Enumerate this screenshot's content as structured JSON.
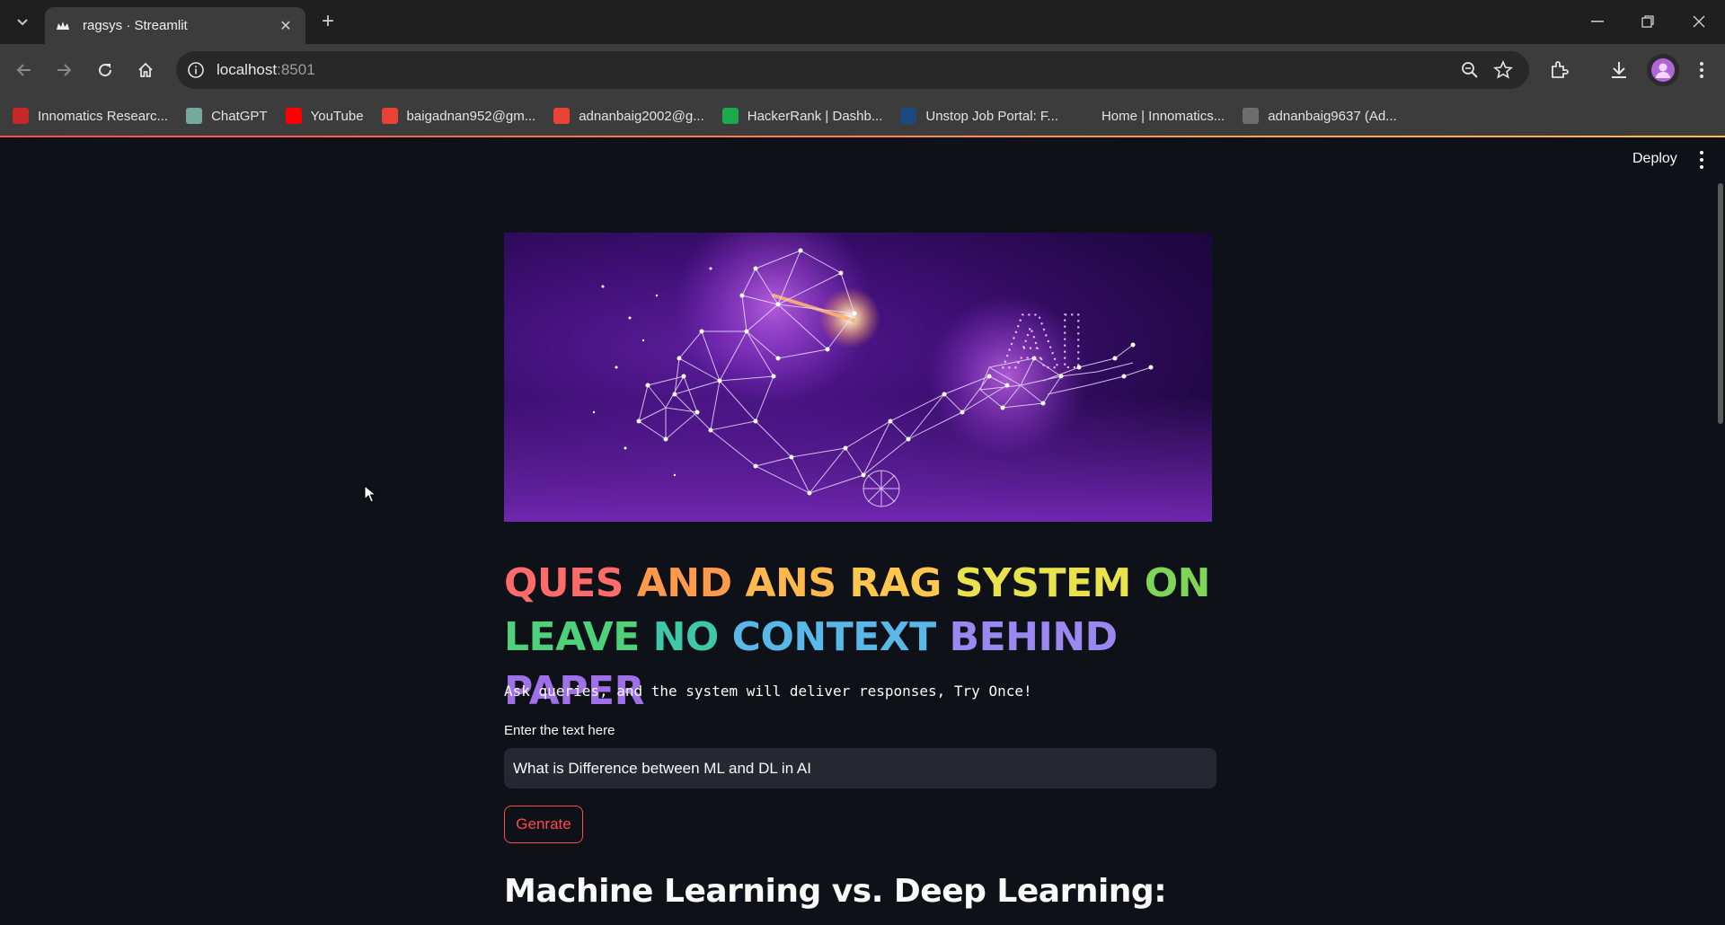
{
  "browser": {
    "tab_title": "ragsys · Streamlit",
    "url_host": "localhost",
    "url_port": ":8501",
    "bookmarks": [
      {
        "label": "Innomatics Researc...",
        "icon": "innomatics-icon",
        "color": "#c62828"
      },
      {
        "label": "ChatGPT",
        "icon": "chatgpt-icon",
        "color": "#74aa9c"
      },
      {
        "label": "YouTube",
        "icon": "youtube-icon",
        "color": "#ff0000"
      },
      {
        "label": "baigadnan952@gm...",
        "icon": "gmail-icon",
        "color": "#ea4335"
      },
      {
        "label": "adnanbaig2002@g...",
        "icon": "gmail-icon",
        "color": "#ea4335"
      },
      {
        "label": "HackerRank | Dashb...",
        "icon": "hackerrank-icon",
        "color": "#1ba94c"
      },
      {
        "label": "Unstop Job Portal: F...",
        "icon": "unstop-icon",
        "color": "#1c4980"
      },
      {
        "label": "Home | Innomatics...",
        "icon": "blank-icon",
        "color": "#3c3c3c"
      },
      {
        "label": "adnanbaig9637 (Ad...",
        "icon": "github-icon",
        "color": "#6e6e6e"
      }
    ]
  },
  "app": {
    "deploy_label": "Deploy",
    "title_words": [
      {
        "text": "QUES",
        "color": "#ff6b6b"
      },
      {
        "text": "AND",
        "color": "#ff9a4d"
      },
      {
        "text": "ANS",
        "color": "#ffb84d"
      },
      {
        "text": "RAG",
        "color": "#ffc84d"
      },
      {
        "text": "SYSTEM",
        "color": "#e8e24d"
      },
      {
        "text": "ON",
        "color": "#7fd45a"
      },
      {
        "text": "LEAVE",
        "color": "#4fd07a"
      },
      {
        "text": "NO",
        "color": "#3ec8a8"
      },
      {
        "text": "CONTEXT",
        "color": "#5ab8e8"
      },
      {
        "text": "BEHIND",
        "color": "#9a88f0"
      },
      {
        "text": "PAPER",
        "color": "#a070e8"
      }
    ],
    "subtitle": "Ask queries, and the system will deliver responses, Try Once!",
    "input_label": "Enter the text here",
    "input_value": "What is Difference between ML and DL in AI",
    "button_label": "Genrate",
    "answer_heading": "Machine Learning vs. Deep Learning:",
    "hero_text": "AI"
  },
  "colors": {
    "accent": "#ff4b4b",
    "background": "#0e1117",
    "input_bg": "#262730"
  }
}
